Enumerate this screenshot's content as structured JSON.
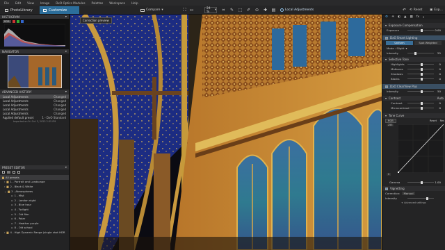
{
  "menubar": [
    "File",
    "Edit",
    "View",
    "Image",
    "DxO Optics Modules",
    "Palettes",
    "Workspace",
    "Help"
  ],
  "toolbar": {
    "tab_library": "PhotoLibrary",
    "tab_customize": "Customize",
    "compare": "Compare",
    "zoom": "24 %",
    "local_adjustments": "Local Adjustments",
    "reset": "Reset",
    "export": "Exp..."
  },
  "left": {
    "histogram_title": "HISTOGRAM",
    "channels": "RGB",
    "navigator_title": "NAVIGATOR",
    "history_title": "ADVANCED HISTORY",
    "history": [
      {
        "label": "Local Adjustments",
        "status": "Changed"
      },
      {
        "label": "Local Adjustments",
        "status": "Changed"
      },
      {
        "label": "Local Adjustments",
        "status": "Changed"
      },
      {
        "label": "Local Adjustments",
        "status": "Changed"
      },
      {
        "label": "Local Adjustments",
        "status": "Changed"
      },
      {
        "label": "Applied default preset",
        "status": "1 - DxO Standard"
      }
    ],
    "history_footer": "Imported on Fri Oct 3, 2023 2:35 PM",
    "preset_title": "PRESET EDITOR",
    "presets": [
      "All presets",
      "1 - Portrait and Landscape",
      "2 - Black & White",
      "3 - Atmospheres",
      "1 - Mist",
      "2 - London night",
      "3 - Blue hour",
      "4 - Twilight",
      "5 - Old film",
      "6 - Polar",
      "7 - Heather purple",
      "8 - Old school",
      "4 - High Dynamic Range (single shot HDR"
    ]
  },
  "main": {
    "badge": "Correction preview"
  },
  "right": {
    "exposure_section": "Exposure Compensation",
    "exposure_label": "Exposure",
    "exposure_value": "0.00",
    "smart_section": "DxO Smart Lighting",
    "smart_opt1": "Uniform",
    "smart_opt2": "Spot Weighted",
    "mode_label": "Mode : Slight",
    "intensity_label": "Intensity",
    "intensity_value": "25",
    "selective_section": "Selective Tone",
    "tone_rows": [
      {
        "label": "Highlights",
        "value": "0"
      },
      {
        "label": "Midtones",
        "value": "0"
      },
      {
        "label": "Shadows",
        "value": "0"
      },
      {
        "label": "Blacks",
        "value": "0"
      }
    ],
    "clearview_section": "DxO ClearView Plus",
    "clearview_intensity": "50",
    "contrast_section": "Contrast",
    "contrast_auto": "Auto",
    "contrast_rows": [
      {
        "label": "Contrast",
        "value": "0"
      },
      {
        "label": "Microcontrast",
        "value": "0"
      }
    ],
    "tonecurve_section": "Tone Curve",
    "curve_channel": "RGB",
    "curve_reset": "Reset",
    "curve_reset2": "Res",
    "curve_in": "255",
    "curve_val_0": "0",
    "gamma_label": "Gamma",
    "gamma_value": "1.00",
    "vignetting_label": "Vignetting",
    "correction_label": "Correction:",
    "correction_value": "Manual",
    "vig_intensity_label": "Intensity",
    "advanced_settings": "Advanced settings"
  }
}
